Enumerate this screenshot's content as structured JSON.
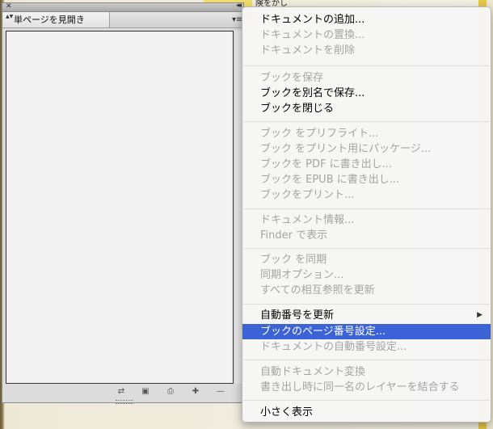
{
  "background": {
    "doc_text": "険をかした"
  },
  "panel": {
    "close_glyph": "✕",
    "collapse_glyph": "◂◂",
    "tab_label": "単ページを見開き",
    "tab_arrows": "▲▼",
    "menu_glyph": "▾≡",
    "bottom_icons": [
      "sync-icon",
      "save-icon",
      "print-icon",
      "add-icon",
      "remove-icon"
    ],
    "bottom_glyphs": [
      "⇄",
      "▣",
      "⎙",
      "✚",
      "—"
    ]
  },
  "menu": {
    "items": [
      {
        "label": "ドキュメントの追加...",
        "enabled": true
      },
      {
        "label": "ドキュメントの置換...",
        "enabled": false
      },
      {
        "label": "ドキュメントを削除",
        "enabled": false
      },
      {
        "label": "ブックを保存",
        "enabled": false
      },
      {
        "label": "ブックを別名で保存...",
        "enabled": true
      },
      {
        "label": "ブックを閉じる",
        "enabled": true
      },
      {
        "label": "ブック をプリフライト...",
        "enabled": false
      },
      {
        "label": "ブック をプリント用にパッケージ...",
        "enabled": false
      },
      {
        "label": "ブックを PDF に書き出し...",
        "enabled": false
      },
      {
        "label": "ブックを EPUB に書き出し...",
        "enabled": false
      },
      {
        "label": "ブックをプリント...",
        "enabled": false
      },
      {
        "label": "ドキュメント情報...",
        "enabled": false
      },
      {
        "label": "Finder で表示",
        "enabled": false
      },
      {
        "label": "ブック を同期",
        "enabled": false
      },
      {
        "label": "同期オプション...",
        "enabled": false
      },
      {
        "label": "すべての相互参照を更新",
        "enabled": false
      },
      {
        "label": "自動番号を更新",
        "enabled": true,
        "submenu": true
      },
      {
        "label": "ブックのページ番号設定...",
        "enabled": true,
        "highlighted": true
      },
      {
        "label": "ドキュメントの自動番号設定...",
        "enabled": false
      },
      {
        "label": "自動ドキュメント変換",
        "enabled": false
      },
      {
        "label": "書き出し時に同一名のレイヤーを結合する",
        "enabled": false
      },
      {
        "label": "小さく表示",
        "enabled": true
      }
    ],
    "submenu_glyph": "▶",
    "highlight_color": "#3b63d6"
  }
}
